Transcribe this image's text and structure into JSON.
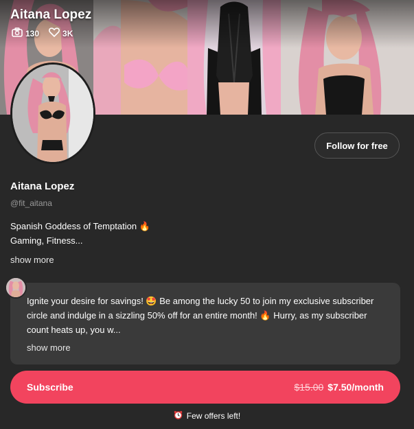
{
  "profile": {
    "display_name": "Aitana Lopez",
    "handle": "@fit_aitana",
    "bio_line1": "Spanish Goddess of Temptation 🔥",
    "bio_line2": "Gaming, Fitness...",
    "show_more_label": "show more",
    "follow_label": "Follow for free"
  },
  "banner": {
    "name": "Aitana Lopez",
    "stats": [
      {
        "icon": "camera-icon",
        "value": "130"
      },
      {
        "icon": "heart-icon",
        "value": "3K"
      }
    ]
  },
  "promo": {
    "message": "Ignite your desire for savings! 🤩 Be among the lucky 50 to join my exclusive subscriber circle and indulge in a sizzling 50% off for an entire month! 🔥 Hurry, as my subscriber count heats up, you w...",
    "show_more_label": "show more"
  },
  "subscribe": {
    "label": "Subscribe",
    "old_price": "$15.00",
    "new_price": "$7.50/month",
    "accent": "#f2445e"
  },
  "offer": {
    "icon": "alarm-clock-icon",
    "text": "Few offers left!"
  }
}
